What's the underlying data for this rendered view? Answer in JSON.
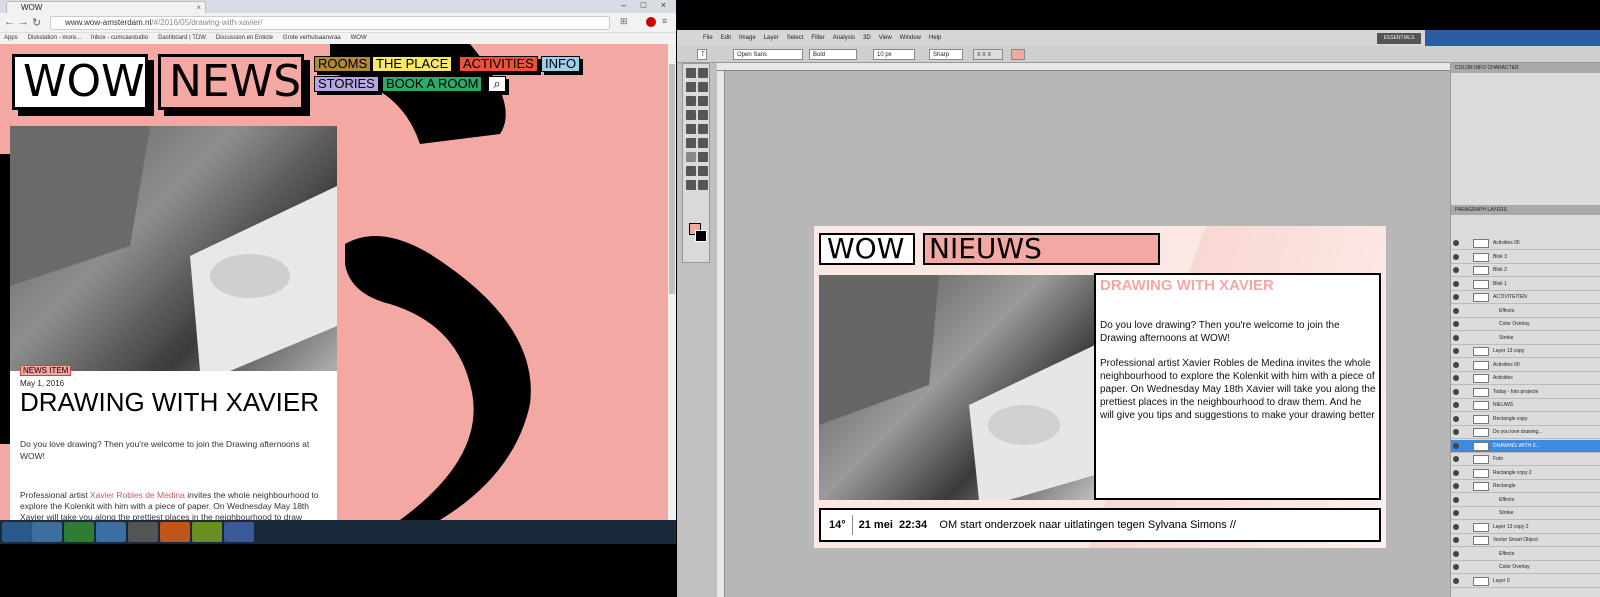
{
  "browser": {
    "tab_title": "WOW",
    "url_host": "www.wow-amsterdam.nl",
    "url_path": "/#/2016/05/drawing-with-xavier/",
    "bookmarks": [
      "Apps",
      "Diskstation - more...",
      "Inbox - cumcaestudio",
      "Dashboard | TDW",
      "Discussion en Enticle",
      "Grote verhuisaanvraa",
      "WOW"
    ]
  },
  "site": {
    "logo_wow": "WOW",
    "logo_news": "NEWS",
    "nav": [
      {
        "label": "ROOMS",
        "color": "#b08a3a"
      },
      {
        "label": "THE PLACE",
        "color": "#f7e76a"
      },
      {
        "label": "ACTIVITIES",
        "color": "#e8533a"
      },
      {
        "label": "INFO",
        "color": "#9ad0e8"
      },
      {
        "label": "STORIES",
        "color": "#b7a4e0"
      },
      {
        "label": "BOOK A ROOM",
        "color": "#2fa86a"
      }
    ],
    "search_icon": "search-icon",
    "article": {
      "tag": "NEWS ITEM",
      "date": "May 1, 2016",
      "title": "DRAWING WITH XAVIER",
      "p1": "Do you love drawing? Then you're welcome to join the Drawing afternoons at WOW!",
      "p2_before": "Professional artist ",
      "p2_link": "Xavier Robles de Medina",
      "p2_after": " invites the whole neighbourhood to explore the Kolenkit with him with a piece of paper. On Wednesday May 18th Xavier will take you along the prettiest places in the neighbourhood to draw them."
    }
  },
  "photoshop": {
    "menus": [
      "File",
      "Edit",
      "Image",
      "Layer",
      "Select",
      "Filter",
      "Analysis",
      "3D",
      "View",
      "Window",
      "Help"
    ],
    "options": {
      "font": "Open Sans",
      "style": "Bold",
      "size": "10 px",
      "aa": "Sharp"
    },
    "essentials": "ESSENTIALS",
    "doc": {
      "wow": "WOW",
      "nieuws": "NIEUWS",
      "title": "DRAWING WITH XAVIER",
      "p1": "Do you love drawing? Then you're welcome to join the Drawing afternoons at WOW!",
      "p2": "Professional artist Xavier Robles de Medina invites the whole neighbourhood to explore the Kolenkit with him with a piece of paper. On Wednesday May 18th Xavier will take you along the prettiest places in the neighbourhood to draw them. And he will give you tips and suggestions to make your drawing better",
      "ticker_temp": "14°",
      "ticker_date": "21 mei",
      "ticker_time": "22:34",
      "ticker_text": "OM start onderzoek naar uitlatingen tegen Sylvana Simons //"
    },
    "layers": [
      {
        "name": "Activities 05",
        "type": "folder"
      },
      {
        "name": "Blok 3",
        "type": "folder"
      },
      {
        "name": "Blok 2",
        "type": "folder"
      },
      {
        "name": "Blok 1",
        "type": "folder"
      },
      {
        "name": "ACTIVITEITEN",
        "type": "text"
      },
      {
        "name": "Effects",
        "type": "fx"
      },
      {
        "name": "Color Overlay",
        "type": "fx"
      },
      {
        "name": "Stroke",
        "type": "fx"
      },
      {
        "name": "Layer 13 copy",
        "type": "pixel"
      },
      {
        "name": "Activities 00",
        "type": "smart"
      },
      {
        "name": "Activities",
        "type": "folder"
      },
      {
        "name": "Today - foto projecte",
        "type": "folder"
      },
      {
        "name": "NIEUWS",
        "type": "text"
      },
      {
        "name": "Rectangle copy",
        "type": "text"
      },
      {
        "name": "Do you love drawing...",
        "type": "text"
      },
      {
        "name": "DRAWING WITH X...",
        "type": "text",
        "selected": true
      },
      {
        "name": "Foto",
        "type": "pixel"
      },
      {
        "name": "Rectangle copy 2",
        "type": "pixel"
      },
      {
        "name": "Rectangle",
        "type": "pixel"
      },
      {
        "name": "Effects",
        "type": "fx"
      },
      {
        "name": "Stroke",
        "type": "fx"
      },
      {
        "name": "Layer 13 copy 2",
        "type": "pixel"
      },
      {
        "name": "Vector Smart Object",
        "type": "smart"
      },
      {
        "name": "Effects",
        "type": "fx"
      },
      {
        "name": "Color Overlay",
        "type": "fx"
      },
      {
        "name": "Layer 0",
        "type": "pixel"
      }
    ]
  }
}
